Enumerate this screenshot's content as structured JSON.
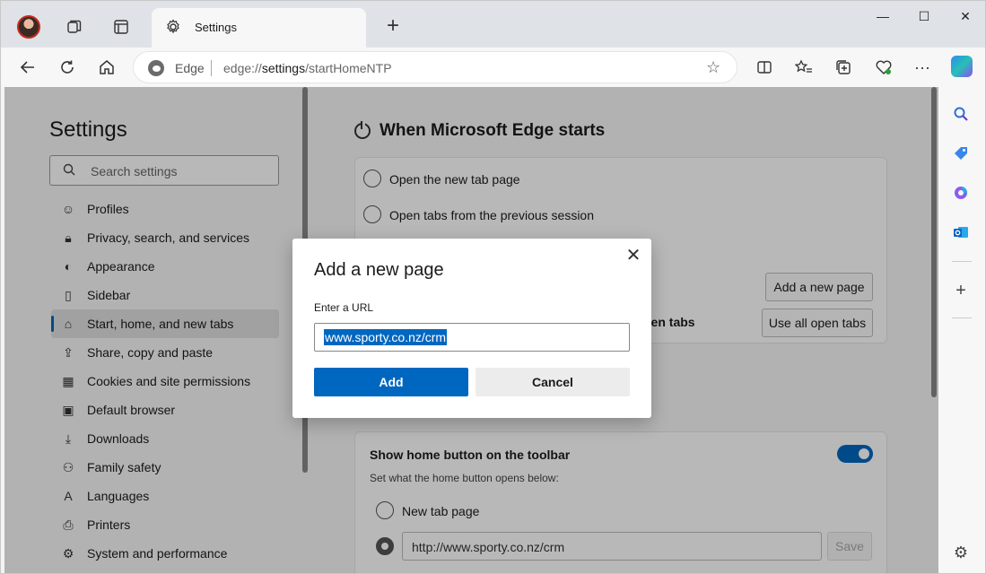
{
  "window": {
    "tab_title": "Settings",
    "new_tab_symbol": "+",
    "minimize_symbol": "—",
    "maximize_symbol": "☐",
    "close_symbol": "✕"
  },
  "address_bar": {
    "site_name": "Edge",
    "url_scheme": "edge://",
    "url_host": "settings",
    "url_path": "/startHomeNTP"
  },
  "sidebar": {
    "title": "Settings",
    "search_placeholder": "Search settings",
    "items": [
      {
        "label": "Profiles",
        "icon": "profile-icon"
      },
      {
        "label": "Privacy, search, and services",
        "icon": "lock-icon"
      },
      {
        "label": "Appearance",
        "icon": "palette-icon"
      },
      {
        "label": "Sidebar",
        "icon": "sidebar-icon"
      },
      {
        "label": "Start, home, and new tabs",
        "icon": "home-tabs-icon",
        "active": true
      },
      {
        "label": "Share, copy and paste",
        "icon": "share-icon"
      },
      {
        "label": "Cookies and site permissions",
        "icon": "cookies-icon"
      },
      {
        "label": "Default browser",
        "icon": "browser-icon"
      },
      {
        "label": "Downloads",
        "icon": "download-icon"
      },
      {
        "label": "Family safety",
        "icon": "family-icon"
      },
      {
        "label": "Languages",
        "icon": "languages-icon"
      },
      {
        "label": "Printers",
        "icon": "printer-icon"
      },
      {
        "label": "System and performance",
        "icon": "system-icon"
      }
    ]
  },
  "main": {
    "section_title": "When Microsoft Edge starts",
    "option_new_tab": "Open the new tab page",
    "option_previous": "Open tabs from the previous session",
    "add_page_button": "Add a new page",
    "use_open_tabs_partial": "pen tabs",
    "use_all_open_tabs_button": "Use all open tabs",
    "home_button_title": "Show home button on the toolbar",
    "home_button_subtitle": "Set what the home button opens below:",
    "home_option_new_tab": "New tab page",
    "home_url_value": "http://www.sporty.co.nz/crm",
    "save_button": "Save",
    "home_toggle_on": true
  },
  "dialog": {
    "title": "Add a new page",
    "close_symbol": "✕",
    "url_label": "Enter a URL",
    "url_value": "www.sporty.co.nz/crm",
    "add_button": "Add",
    "cancel_button": "Cancel"
  },
  "colors": {
    "accent": "#0067c0",
    "overlay": "rgba(0,0,0,0.28)"
  }
}
